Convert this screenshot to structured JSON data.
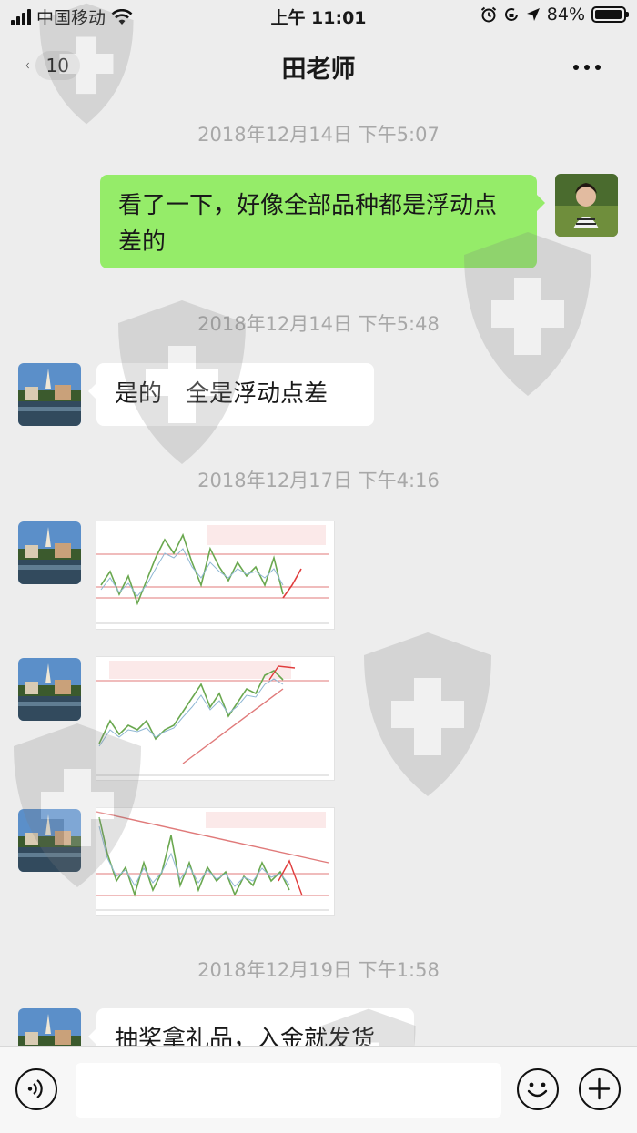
{
  "status_bar": {
    "carrier": "中国移动",
    "time": "上午 11:01",
    "battery": "84%",
    "battery_level": 0.84
  },
  "nav": {
    "unread_count": "10",
    "title": "田老师"
  },
  "messages": [
    {
      "timestamp": "2018年12月14日 下午5:07"
    },
    {
      "from": "self",
      "text": "看了一下，好像全部品种都是浮动点差的"
    },
    {
      "timestamp": "2018年12月14日 下午5:48"
    },
    {
      "from": "other",
      "text": "是的　全是浮动点差"
    },
    {
      "timestamp": "2018年12月17日 下午4:16"
    },
    {
      "from": "other",
      "type": "image",
      "content": "chart-image"
    },
    {
      "from": "other",
      "type": "image",
      "content": "chart-image"
    },
    {
      "from": "other",
      "type": "image",
      "content": "chart-image"
    },
    {
      "timestamp": "2018年12月19日 下午1:58"
    },
    {
      "from": "other",
      "text": "抽奖拿礼品，入金就发货"
    }
  ],
  "input_bar": {
    "voice_icon": "voice-icon",
    "emoji_icon": "emoji-icon",
    "plus_icon": "plus-icon",
    "placeholder": ""
  },
  "colors": {
    "background": "#ededed",
    "self_bubble": "#95ec69",
    "other_bubble": "#ffffff",
    "timestamp": "#a8a8a8"
  }
}
